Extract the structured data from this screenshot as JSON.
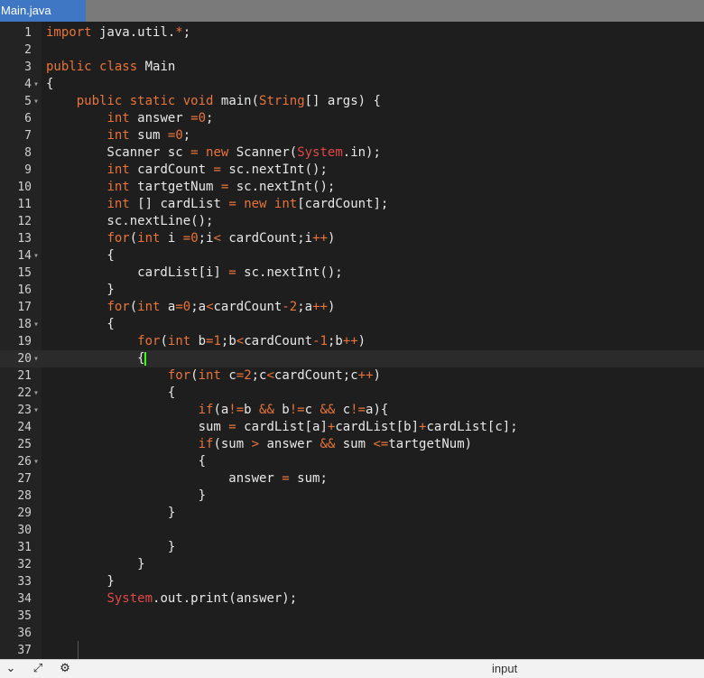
{
  "tab": {
    "label": "Main.java"
  },
  "editor": {
    "lines": [
      {
        "n": "1",
        "fold": false,
        "tokens": [
          [
            "kw",
            "import"
          ],
          [
            "p",
            " java.util."
          ],
          [
            "op",
            "*"
          ],
          [
            "p",
            ";"
          ]
        ]
      },
      {
        "n": "2",
        "fold": false,
        "tokens": []
      },
      {
        "n": "3",
        "fold": false,
        "tokens": [
          [
            "kw",
            "public"
          ],
          [
            "p",
            " "
          ],
          [
            "kw",
            "class"
          ],
          [
            "p",
            " Main"
          ]
        ]
      },
      {
        "n": "4",
        "fold": true,
        "tokens": [
          [
            "p",
            "{"
          ]
        ]
      },
      {
        "n": "5",
        "fold": true,
        "tokens": [
          [
            "p",
            "    "
          ],
          [
            "kw",
            "public"
          ],
          [
            "p",
            " "
          ],
          [
            "kw",
            "static"
          ],
          [
            "p",
            " "
          ],
          [
            "kw",
            "void"
          ],
          [
            "p",
            " main("
          ],
          [
            "ty",
            "String"
          ],
          [
            "p",
            "[] args) {"
          ]
        ]
      },
      {
        "n": "6",
        "fold": false,
        "tokens": [
          [
            "p",
            "        "
          ],
          [
            "ty",
            "int"
          ],
          [
            "p",
            " answer "
          ],
          [
            "op",
            "="
          ],
          [
            "nm",
            "0"
          ],
          [
            "p",
            ";"
          ]
        ]
      },
      {
        "n": "7",
        "fold": false,
        "tokens": [
          [
            "p",
            "        "
          ],
          [
            "ty",
            "int"
          ],
          [
            "p",
            " sum "
          ],
          [
            "op",
            "="
          ],
          [
            "nm",
            "0"
          ],
          [
            "p",
            ";"
          ]
        ]
      },
      {
        "n": "8",
        "fold": false,
        "tokens": [
          [
            "p",
            "        Scanner sc "
          ],
          [
            "op",
            "="
          ],
          [
            "p",
            " "
          ],
          [
            "kw",
            "new"
          ],
          [
            "p",
            " Scanner("
          ],
          [
            "sys",
            "System"
          ],
          [
            "p",
            ".in);"
          ]
        ]
      },
      {
        "n": "9",
        "fold": false,
        "tokens": [
          [
            "p",
            "        "
          ],
          [
            "ty",
            "int"
          ],
          [
            "p",
            " cardCount "
          ],
          [
            "op",
            "="
          ],
          [
            "p",
            " sc.nextInt();"
          ]
        ]
      },
      {
        "n": "10",
        "fold": false,
        "tokens": [
          [
            "p",
            "        "
          ],
          [
            "ty",
            "int"
          ],
          [
            "p",
            " tartgetNum "
          ],
          [
            "op",
            "="
          ],
          [
            "p",
            " sc.nextInt();"
          ]
        ]
      },
      {
        "n": "11",
        "fold": false,
        "tokens": [
          [
            "p",
            "        "
          ],
          [
            "ty",
            "int"
          ],
          [
            "p",
            " [] cardList "
          ],
          [
            "op",
            "="
          ],
          [
            "p",
            " "
          ],
          [
            "kw",
            "new"
          ],
          [
            "p",
            " "
          ],
          [
            "ty",
            "int"
          ],
          [
            "p",
            "[cardCount];"
          ]
        ]
      },
      {
        "n": "12",
        "fold": false,
        "tokens": [
          [
            "p",
            "        sc.nextLine();"
          ]
        ]
      },
      {
        "n": "13",
        "fold": false,
        "tokens": [
          [
            "p",
            "        "
          ],
          [
            "kw",
            "for"
          ],
          [
            "p",
            "("
          ],
          [
            "ty",
            "int"
          ],
          [
            "p",
            " i "
          ],
          [
            "op",
            "="
          ],
          [
            "nm",
            "0"
          ],
          [
            "p",
            ";i"
          ],
          [
            "op",
            "<"
          ],
          [
            "p",
            " cardCount;i"
          ],
          [
            "op",
            "++"
          ],
          [
            "p",
            ")"
          ]
        ]
      },
      {
        "n": "14",
        "fold": true,
        "tokens": [
          [
            "p",
            "        {"
          ]
        ]
      },
      {
        "n": "15",
        "fold": false,
        "tokens": [
          [
            "p",
            "            cardList[i] "
          ],
          [
            "op",
            "="
          ],
          [
            "p",
            " sc.nextInt();"
          ]
        ]
      },
      {
        "n": "16",
        "fold": false,
        "tokens": [
          [
            "p",
            "        }"
          ]
        ]
      },
      {
        "n": "17",
        "fold": false,
        "tokens": [
          [
            "p",
            "        "
          ],
          [
            "kw",
            "for"
          ],
          [
            "p",
            "("
          ],
          [
            "ty",
            "int"
          ],
          [
            "p",
            " a"
          ],
          [
            "op",
            "="
          ],
          [
            "nm",
            "0"
          ],
          [
            "p",
            ";a"
          ],
          [
            "op",
            "<"
          ],
          [
            "p",
            "cardCount"
          ],
          [
            "op",
            "-"
          ],
          [
            "nm",
            "2"
          ],
          [
            "p",
            ";a"
          ],
          [
            "op",
            "++"
          ],
          [
            "p",
            ")"
          ]
        ]
      },
      {
        "n": "18",
        "fold": true,
        "tokens": [
          [
            "p",
            "        {"
          ]
        ]
      },
      {
        "n": "19",
        "fold": false,
        "tokens": [
          [
            "p",
            "            "
          ],
          [
            "kw",
            "for"
          ],
          [
            "p",
            "("
          ],
          [
            "ty",
            "int"
          ],
          [
            "p",
            " b"
          ],
          [
            "op",
            "="
          ],
          [
            "nm",
            "1"
          ],
          [
            "p",
            ";b"
          ],
          [
            "op",
            "<"
          ],
          [
            "p",
            "cardCount"
          ],
          [
            "op",
            "-"
          ],
          [
            "nm",
            "1"
          ],
          [
            "p",
            ";b"
          ],
          [
            "op",
            "++"
          ],
          [
            "p",
            ")"
          ]
        ]
      },
      {
        "n": "20",
        "fold": true,
        "active": true,
        "cursor": true,
        "tokens": [
          [
            "p",
            "            {"
          ]
        ]
      },
      {
        "n": "21",
        "fold": false,
        "tokens": [
          [
            "p",
            "                "
          ],
          [
            "kw",
            "for"
          ],
          [
            "p",
            "("
          ],
          [
            "ty",
            "int"
          ],
          [
            "p",
            " c"
          ],
          [
            "op",
            "="
          ],
          [
            "nm",
            "2"
          ],
          [
            "p",
            ";c"
          ],
          [
            "op",
            "<"
          ],
          [
            "p",
            "cardCount;c"
          ],
          [
            "op",
            "++"
          ],
          [
            "p",
            ")"
          ]
        ]
      },
      {
        "n": "22",
        "fold": true,
        "tokens": [
          [
            "p",
            "                {"
          ]
        ]
      },
      {
        "n": "23",
        "fold": true,
        "tokens": [
          [
            "p",
            "                    "
          ],
          [
            "kw",
            "if"
          ],
          [
            "p",
            "(a"
          ],
          [
            "op",
            "!="
          ],
          [
            "p",
            "b "
          ],
          [
            "op",
            "&&"
          ],
          [
            "p",
            " b"
          ],
          [
            "op",
            "!="
          ],
          [
            "p",
            "c "
          ],
          [
            "op",
            "&&"
          ],
          [
            "p",
            " c"
          ],
          [
            "op",
            "!="
          ],
          [
            "p",
            "a){"
          ]
        ]
      },
      {
        "n": "24",
        "fold": false,
        "tokens": [
          [
            "p",
            "                    sum "
          ],
          [
            "op",
            "="
          ],
          [
            "p",
            " cardList[a]"
          ],
          [
            "op",
            "+"
          ],
          [
            "p",
            "cardList[b]"
          ],
          [
            "op",
            "+"
          ],
          [
            "p",
            "cardList[c];"
          ]
        ]
      },
      {
        "n": "25",
        "fold": false,
        "tokens": [
          [
            "p",
            "                    "
          ],
          [
            "kw",
            "if"
          ],
          [
            "p",
            "(sum "
          ],
          [
            "op",
            ">"
          ],
          [
            "p",
            " answer "
          ],
          [
            "op",
            "&&"
          ],
          [
            "p",
            " sum "
          ],
          [
            "op",
            "<="
          ],
          [
            "p",
            "tartgetNum)"
          ]
        ]
      },
      {
        "n": "26",
        "fold": true,
        "tokens": [
          [
            "p",
            "                    {"
          ]
        ]
      },
      {
        "n": "27",
        "fold": false,
        "tokens": [
          [
            "p",
            "                        answer "
          ],
          [
            "op",
            "="
          ],
          [
            "p",
            " sum;"
          ]
        ]
      },
      {
        "n": "28",
        "fold": false,
        "tokens": [
          [
            "p",
            "                    }"
          ]
        ]
      },
      {
        "n": "29",
        "fold": false,
        "tokens": [
          [
            "p",
            "                }"
          ]
        ]
      },
      {
        "n": "30",
        "fold": false,
        "tokens": []
      },
      {
        "n": "31",
        "fold": false,
        "tokens": [
          [
            "p",
            "                }"
          ]
        ]
      },
      {
        "n": "32",
        "fold": false,
        "tokens": [
          [
            "p",
            "            }"
          ]
        ]
      },
      {
        "n": "33",
        "fold": false,
        "tokens": [
          [
            "p",
            "        }"
          ]
        ]
      },
      {
        "n": "34",
        "fold": false,
        "tokens": [
          [
            "p",
            "        "
          ],
          [
            "sys",
            "System"
          ],
          [
            "p",
            ".out.print(answer);"
          ]
        ]
      },
      {
        "n": "35",
        "fold": false,
        "tokens": []
      },
      {
        "n": "36",
        "fold": false,
        "tokens": []
      },
      {
        "n": "37",
        "fold": false,
        "tokens": []
      }
    ]
  },
  "statusbar": {
    "icons": [
      "chevron-down-icon",
      "expand-arrows-icon",
      "debug-icon"
    ],
    "input_label": "input"
  },
  "colors": {
    "tab_bg": "#3f77c4",
    "keyword": "#e8743b",
    "system": "#e04848",
    "cursor": "#39ff14",
    "editor_bg": "#1e1e1e"
  }
}
